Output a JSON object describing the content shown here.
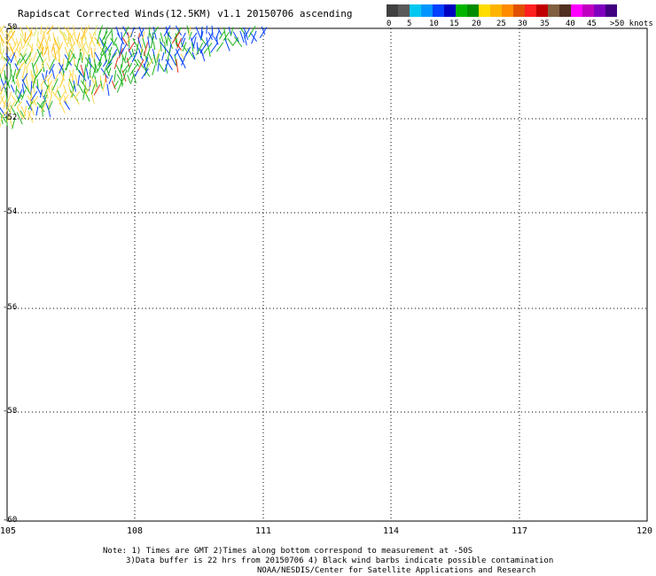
{
  "header": {
    "title": "Rapidscat Corrected Winds(12.5KM) v1.1 20150706 ascending"
  },
  "colorbar": {
    "colors": [
      "#404040",
      "#5a5a5a",
      "#00c8f0",
      "#0096ff",
      "#0040ff",
      "#0000c0",
      "#00b400",
      "#008c00",
      "#ffdc00",
      "#ffb400",
      "#ff8c00",
      "#e05000",
      "#ff2020",
      "#c00000",
      "#806040",
      "#503020",
      "#ff00ff",
      "#c000c0",
      "#8000c0",
      "#400080"
    ],
    "labels": [
      "0",
      "5",
      "10",
      "15",
      "20",
      "25",
      "30",
      "35",
      "40",
      "45",
      ">50 knots"
    ]
  },
  "map": {
    "lat_labels": [
      "-50",
      "-52",
      "-54",
      "-56",
      "-58",
      "-60"
    ],
    "lon_labels": [
      "105",
      "108",
      "111",
      "114",
      "117",
      "120"
    ]
  },
  "notes": {
    "line1": "Note: 1) Times are GMT 2)Times along bottom correspond to measurement at -50S",
    "line2": "3)Data buffer is 22 hrs from 20150706 4) Black wind barbs indicate possible contamination",
    "line3": "NOAA/NESDIS/Center for Satellite Applications and Research"
  }
}
